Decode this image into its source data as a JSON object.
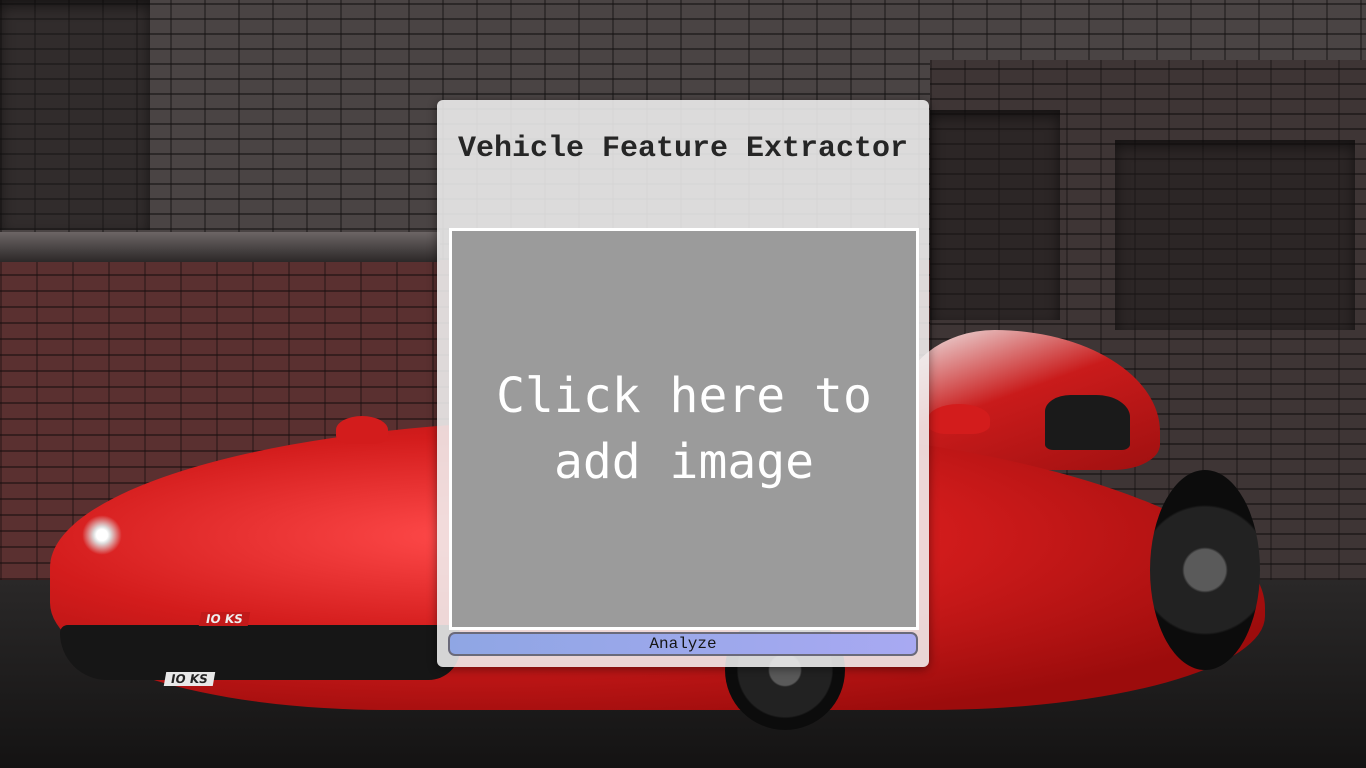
{
  "app": {
    "title": "Vehicle Feature Extractor"
  },
  "dropzone": {
    "prompt": "Click here to add image",
    "icon": "image-upload-area"
  },
  "actions": {
    "analyze_label": "Analyze"
  },
  "background": {
    "description_plates": [
      "IO KS",
      "IO KS"
    ]
  },
  "colors": {
    "card_background": "#f0f0f0",
    "dropzone_background": "#9b9b9b",
    "button_gradient_start": "#8fa6e4",
    "button_gradient_end": "#a8a9f2",
    "title_text": "#262626"
  }
}
